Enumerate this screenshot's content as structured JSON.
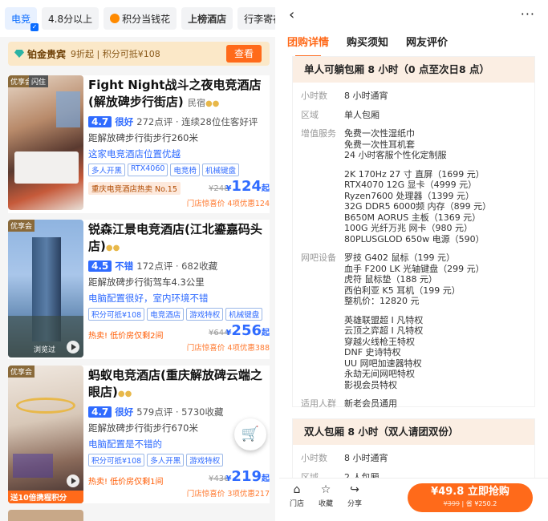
{
  "filters": [
    "电竞",
    "4.8分以上",
    "积分当钱花",
    "上榜酒店",
    "行李寄存"
  ],
  "member": {
    "level": "铂金贵宾",
    "desc": "9折起 | 积分可抵¥108",
    "button": "查看"
  },
  "hotels": [
    {
      "tag": "优享会",
      "tag2": "闪住",
      "name": "Fight Night战斗之夜电竞酒店(解放碑步行街店)",
      "kind": "民宿",
      "score": "4.7",
      "level": "很好",
      "stats": "272点评 · 连续28位住客好评",
      "dist": "距解放碑步行街步行260米",
      "highlight": "这家电竞酒店位置优越",
      "tags": [
        "多人开黑",
        "RTX4060",
        "电竞椅",
        "机械键盘"
      ],
      "rank": "重庆电竞酒店热卖 No.15",
      "old": "¥248",
      "price": "124",
      "promo": "门店惊喜价 4项优惠124"
    },
    {
      "tag": "优享会",
      "name": "锐森江景电竞酒店(江北鎏嘉码头店)",
      "score": "4.5",
      "level": "不错",
      "stats": "172点评 · 682收藏",
      "dist": "距解放碑步行街驾车4.3公里",
      "highlight": "电脑配置很好，室内环境不错",
      "tags": [
        "积分可抵¥108",
        "电竞酒店",
        "游戏特权",
        "机械键盘"
      ],
      "hot": "热卖! 低价房仅剩2间",
      "old": "¥644",
      "price": "256",
      "promo": "门店惊喜价 4项优惠388",
      "browsed": "浏览过"
    },
    {
      "tag": "优享会",
      "name": "蚂蚁电竞酒店(重庆解放碑云端之眼店)",
      "score": "4.7",
      "level": "很好",
      "stats": "579点评 · 5730收藏",
      "dist": "距解放碑步行街步行670米",
      "highlight": "电脑配置是不错的",
      "tags": [
        "积分可抵¥108",
        "多人开黑",
        "游戏特权"
      ],
      "hot": "热卖! 低价房仅剩1间",
      "old": "¥436",
      "price": "219",
      "promo": "门店惊喜价 3项优惠217",
      "banner": "送10倍携程积分"
    }
  ],
  "price_suffix": "起",
  "detail": {
    "tabs": [
      "团购详情",
      "购买须知",
      "网友评价"
    ],
    "pkg1": {
      "title": "单人可躺包厢 8 小时（0 点至次日8 点）",
      "rows": [
        {
          "k": "小时数",
          "v": [
            "8 小时通宵"
          ]
        },
        {
          "k": "区域",
          "v": [
            "单人包厢"
          ]
        },
        {
          "k": "增值服务",
          "v": [
            "免费一次性湿纸巾",
            "免费一次性耳机套",
            "24 小时客服个性化定制服"
          ]
        },
        {
          "k": "",
          "v": [
            "2K 170Hz  27 寸 直屏（1699 元）",
            "RTX4070 12G 显卡（4999 元）",
            "Ryzen7600 处理器（1399 元）",
            "32G DDR5 6000频 内存（899 元）",
            "B650M AORUS 主板（1369 元）",
            "100G 光纤万兆 网卡（980 元）",
            "80PLUSGLOD 650w 电源（590）"
          ]
        },
        {
          "k": "网吧设备",
          "v": [
            "罗技 G402 鼠标（199 元）",
            "血手 F200 LK 光轴键盘（299 元）",
            "虎符 鼠标垫（188 元）",
            "西伯利亚 K5 耳机（199 元）",
            "整机价：12820 元"
          ]
        },
        {
          "k": "",
          "v": [
            "英雄联盟超 I 凡特权",
            "云顶之弈超 I 凡特权",
            "穿越火线枪王特权",
            "DNF 史诗特权",
            "UU 网吧加速器特权",
            "永劫无间网吧特权",
            "影视会员特权"
          ]
        },
        {
          "k": "适用人群",
          "v": [
            "新老会员通用"
          ]
        }
      ]
    },
    "pkg2": {
      "title": "双人包厢 8 小时（双人请团双份）",
      "rows": [
        {
          "k": "小时数",
          "v": [
            "8 小时通宵"
          ]
        },
        {
          "k": "区域",
          "v": [
            "2 人包厢"
          ]
        }
      ]
    }
  },
  "bottom": {
    "store": "门店",
    "fav": "收藏",
    "share": "分享",
    "buy": "¥49.8 立即抢购",
    "buy_old": "¥399",
    "buy_sub": " | 省 ¥250.2"
  }
}
